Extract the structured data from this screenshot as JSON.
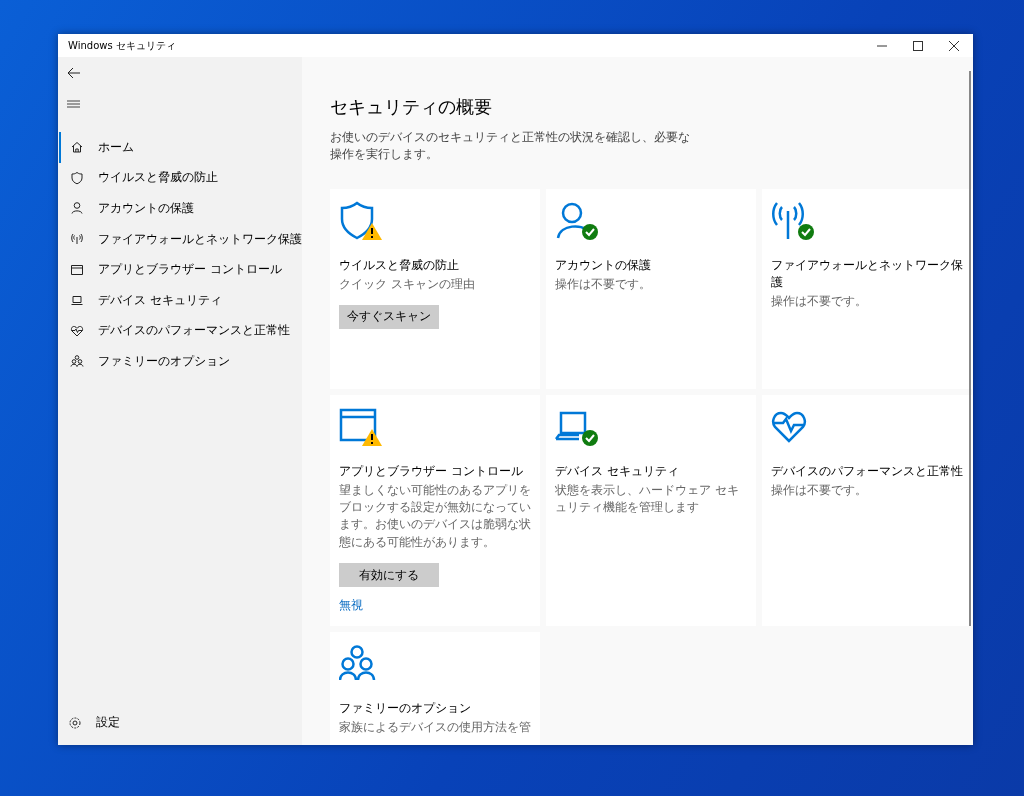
{
  "window": {
    "title": "Windows セキュリティ"
  },
  "sidebar": {
    "items": [
      {
        "label": "ホーム",
        "kind": "home",
        "selected": true
      },
      {
        "label": "ウイルスと脅威の防止",
        "kind": "shield",
        "selected": false
      },
      {
        "label": "アカウントの保護",
        "kind": "person",
        "selected": false
      },
      {
        "label": "ファイアウォールとネットワーク保護",
        "kind": "antenna",
        "selected": false
      },
      {
        "label": "アプリとブラウザー コントロール",
        "kind": "browser",
        "selected": false
      },
      {
        "label": "デバイス セキュリティ",
        "kind": "laptop",
        "selected": false
      },
      {
        "label": "デバイスのパフォーマンスと正常性",
        "kind": "heart",
        "selected": false
      },
      {
        "label": "ファミリーのオプション",
        "kind": "family",
        "selected": false
      }
    ],
    "settings": {
      "label": "設定"
    }
  },
  "main": {
    "title": "セキュリティの概要",
    "description": "お使いのデバイスのセキュリティと正常性の状況を確認し、必要な操作を実行します。",
    "cards": [
      {
        "kind": "shield",
        "warning": true,
        "checked": false,
        "title": "ウイルスと脅威の防止",
        "text": "クイック スキャンの理由",
        "button": "今すぐスキャン"
      },
      {
        "kind": "person",
        "warning": false,
        "checked": true,
        "title": "アカウントの保護",
        "text": "操作は不要です。"
      },
      {
        "kind": "antenna",
        "warning": false,
        "checked": true,
        "title": "ファイアウォールとネットワーク保護",
        "text": "操作は不要です。"
      },
      {
        "kind": "browser",
        "warning": true,
        "checked": false,
        "title": "アプリとブラウザー コントロール",
        "text": "望ましくない可能性のあるアプリをブロックする設定が無効になっています。お使いのデバイスは脆弱な状態にある可能性があります。",
        "button": "有効にする",
        "link": "無視"
      },
      {
        "kind": "laptop",
        "warning": false,
        "checked": true,
        "title": "デバイス セキュリティ",
        "text": "状態を表示し、ハードウェア セキュリティ機能を管理します"
      },
      {
        "kind": "heart",
        "warning": false,
        "checked": false,
        "title": "デバイスのパフォーマンスと正常性",
        "text": "操作は不要です。"
      },
      {
        "kind": "family",
        "warning": false,
        "checked": false,
        "title": "ファミリーのオプション",
        "text": "家族によるデバイスの使用方法を管"
      }
    ]
  }
}
